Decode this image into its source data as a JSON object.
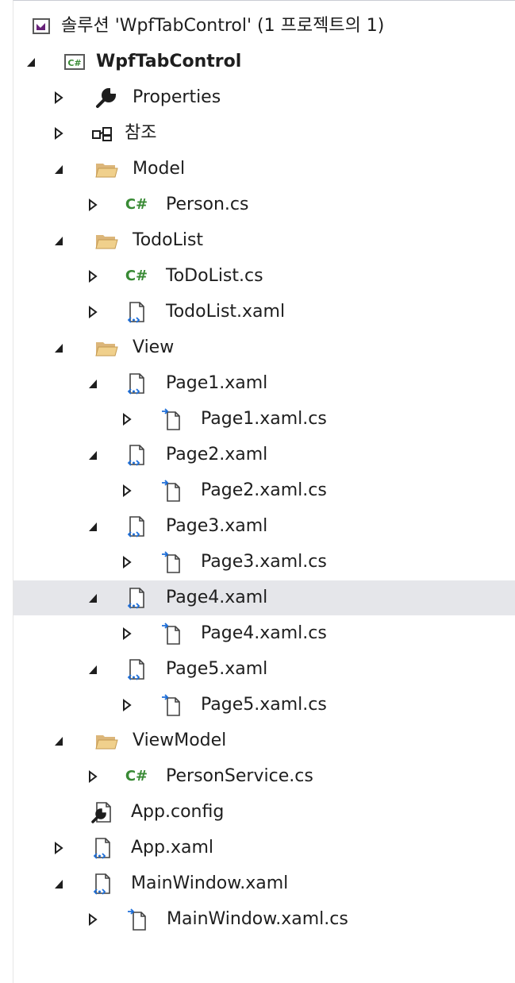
{
  "solution_explorer": {
    "solution_label": "솔루션 'WpfTabControl' (1 프로젝트의 1)",
    "project": {
      "label": "WpfTabControl",
      "icon": "csharp-project-icon"
    },
    "nodes": {
      "properties": "Properties",
      "references": "참조",
      "model": "Model",
      "person_cs": "Person.cs",
      "todolist_folder": "TodoList",
      "todolist_cs": "ToDoList.cs",
      "todolist_xaml": "TodoList.xaml",
      "view": "View",
      "page1_xaml": "Page1.xaml",
      "page1_xaml_cs": "Page1.xaml.cs",
      "page2_xaml": "Page2.xaml",
      "page2_xaml_cs": "Page2.xaml.cs",
      "page3_xaml": "Page3.xaml",
      "page3_xaml_cs": "Page3.xaml.cs",
      "page4_xaml": "Page4.xaml",
      "page4_xaml_cs": "Page4.xaml.cs",
      "page5_xaml": "Page5.xaml",
      "page5_xaml_cs": "Page5.xaml.cs",
      "viewmodel": "ViewModel",
      "personservice_cs": "PersonService.cs",
      "app_config": "App.config",
      "app_xaml": "App.xaml",
      "mainwindow_xaml": "MainWindow.xaml",
      "mainwindow_xaml_cs": "MainWindow.xaml.cs"
    },
    "csharp_glyph": "C#",
    "selected_item": "Page4.xaml"
  },
  "colors": {
    "folder": "#dcb67a",
    "csharp": "#388a34",
    "xaml_blue": "#1e6fd9",
    "selection": "#e5e6ea"
  }
}
